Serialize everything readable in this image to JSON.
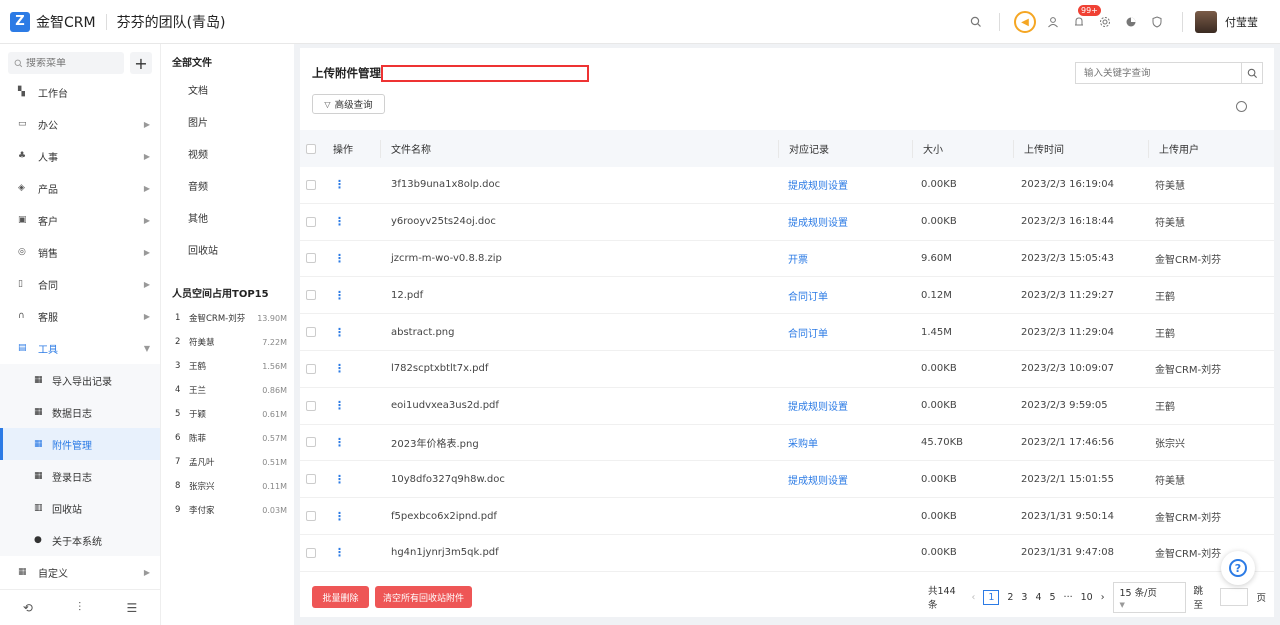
{
  "header": {
    "logo_char": "Z",
    "app_title": "金智CRM",
    "team_name": "芬芬的团队(青岛)",
    "notification_badge": "99+",
    "user_name": "付莹莹"
  },
  "sidebar": {
    "search_placeholder": "搜索菜单",
    "add_label": "+",
    "items": [
      {
        "label": "工作台"
      },
      {
        "label": "办公"
      },
      {
        "label": "人事"
      },
      {
        "label": "产品"
      },
      {
        "label": "客户"
      },
      {
        "label": "销售"
      },
      {
        "label": "合同"
      },
      {
        "label": "客服"
      },
      {
        "label": "工具"
      }
    ],
    "tool_subitems": [
      {
        "label": "导入导出记录"
      },
      {
        "label": "数据日志"
      },
      {
        "label": "附件管理"
      },
      {
        "label": "登录日志"
      },
      {
        "label": "回收站"
      },
      {
        "label": "关于本系统"
      }
    ],
    "custom_label": "自定义"
  },
  "file_panel": {
    "title": "全部文件",
    "categories": [
      "文档",
      "图片",
      "视频",
      "音频",
      "其他",
      "回收站"
    ],
    "top_title": "人员空间占用TOP15",
    "top_users": [
      {
        "rank": "1",
        "name": "金智CRM-刘芬",
        "size": "13.90M"
      },
      {
        "rank": "2",
        "name": "符美慧",
        "size": "7.22M"
      },
      {
        "rank": "3",
        "name": "王鹤",
        "size": "1.56M"
      },
      {
        "rank": "4",
        "name": "王兰",
        "size": "0.86M"
      },
      {
        "rank": "5",
        "name": "于颖",
        "size": "0.61M"
      },
      {
        "rank": "6",
        "name": "陈菲",
        "size": "0.57M"
      },
      {
        "rank": "7",
        "name": "孟凡叶",
        "size": "0.51M"
      },
      {
        "rank": "8",
        "name": "张宗兴",
        "size": "0.11M"
      },
      {
        "rank": "9",
        "name": "李付家",
        "size": "0.03M"
      }
    ]
  },
  "main": {
    "title": "上传附件管理",
    "search_placeholder": "输入关键字查询",
    "advanced_query": "高级查询",
    "columns": {
      "op": "操作",
      "name": "文件名称",
      "record": "对应记录",
      "size": "大小",
      "time": "上传时间",
      "user": "上传用户"
    },
    "rows": [
      {
        "name": "3f13b9una1x8olp.doc",
        "record": "提成规则设置",
        "size": "0.00KB",
        "time": "2023/2/3 16:19:04",
        "user": "符美慧"
      },
      {
        "name": "y6rooyv25ts24oj.doc",
        "record": "提成规则设置",
        "size": "0.00KB",
        "time": "2023/2/3 16:18:44",
        "user": "符美慧"
      },
      {
        "name": "jzcrm-m-wo-v0.8.8.zip",
        "record": "开票",
        "size": "9.60M",
        "time": "2023/2/3 15:05:43",
        "user": "金智CRM-刘芬"
      },
      {
        "name": "12.pdf",
        "record": "合同订单",
        "size": "0.12M",
        "time": "2023/2/3 11:29:27",
        "user": "王鹤"
      },
      {
        "name": "abstract.png",
        "record": "合同订单",
        "size": "1.45M",
        "time": "2023/2/3 11:29:04",
        "user": "王鹤"
      },
      {
        "name": "l782scptxbtlt7x.pdf",
        "record": "",
        "size": "0.00KB",
        "time": "2023/2/3 10:09:07",
        "user": "金智CRM-刘芬"
      },
      {
        "name": "eoi1udvxea3us2d.pdf",
        "record": "提成规则设置",
        "size": "0.00KB",
        "time": "2023/2/3 9:59:05",
        "user": "王鹤"
      },
      {
        "name": "2023年价格表.png",
        "record": "采购单",
        "size": "45.70KB",
        "time": "2023/2/1 17:46:56",
        "user": "张宗兴"
      },
      {
        "name": "10y8dfo327q9h8w.doc",
        "record": "提成规则设置",
        "size": "0.00KB",
        "time": "2023/2/1 15:01:55",
        "user": "符美慧"
      },
      {
        "name": "f5pexbco6x2ipnd.pdf",
        "record": "",
        "size": "0.00KB",
        "time": "2023/1/31 9:50:14",
        "user": "金智CRM-刘芬"
      },
      {
        "name": "hg4n1jynrj3m5qk.pdf",
        "record": "",
        "size": "0.00KB",
        "time": "2023/1/31 9:47:08",
        "user": "金智CRM-刘芬"
      }
    ],
    "batch_delete": "批量删除",
    "clear_recycle": "清空所有回收站附件",
    "pager": {
      "total": "共144条",
      "pages": [
        "1",
        "2",
        "3",
        "4",
        "5",
        "···",
        "10"
      ],
      "page_size": "15 条/页",
      "jump_label": "跳至",
      "page_unit": "页"
    }
  }
}
